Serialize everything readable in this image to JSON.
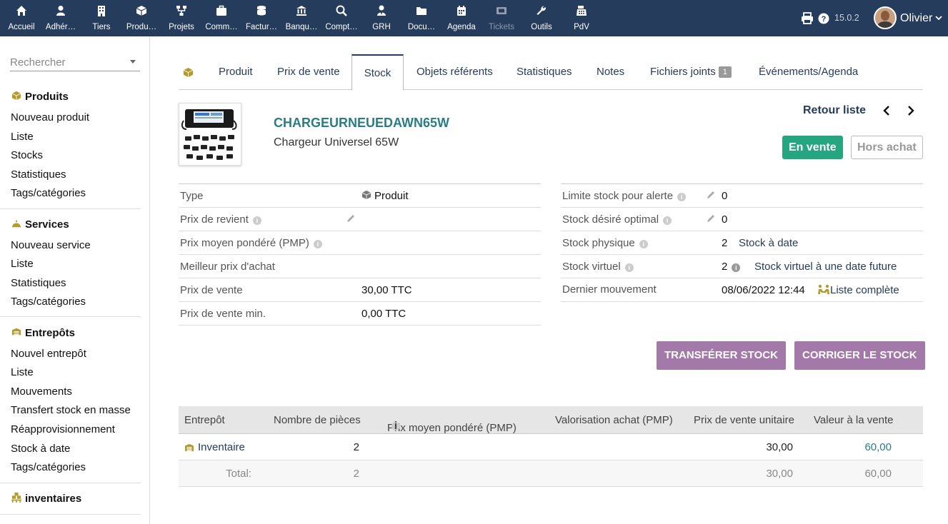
{
  "topnav": {
    "items": [
      {
        "label": "Accueil",
        "icon": "home-icon"
      },
      {
        "label": "Adhér…",
        "icon": "member-icon"
      },
      {
        "label": "Tiers",
        "icon": "building-icon"
      },
      {
        "label": "Produ…",
        "icon": "cube-icon"
      },
      {
        "label": "Projets",
        "icon": "project-icon"
      },
      {
        "label": "Comm…",
        "icon": "briefcase-icon"
      },
      {
        "label": "Factur…",
        "icon": "coins-icon"
      },
      {
        "label": "Banqu…",
        "icon": "bank-icon"
      },
      {
        "label": "Compt…",
        "icon": "search-dollar-icon"
      },
      {
        "label": "GRH",
        "icon": "user-tie-icon"
      },
      {
        "label": "Docu…",
        "icon": "folder-icon"
      },
      {
        "label": "Agenda",
        "icon": "calendar-icon"
      },
      {
        "label": "Tickets",
        "icon": "ticket-icon"
      },
      {
        "label": "Outils",
        "icon": "wrench-icon"
      },
      {
        "label": "PdV",
        "icon": "cash-register-icon"
      }
    ],
    "version": "15.0.2",
    "user": "Olivier"
  },
  "sidebar": {
    "search_placeholder": "Rechercher",
    "groups": [
      {
        "title": "Produits",
        "icon": "cube-icon",
        "items": [
          "Nouveau produit",
          "Liste",
          "Stocks",
          "Statistiques",
          "Tags/catégories"
        ]
      },
      {
        "title": "Services",
        "icon": "bell-service-icon",
        "items": [
          "Nouveau service",
          "Liste",
          "Statistiques",
          "Tags/catégories"
        ]
      },
      {
        "title": "Entrepôts",
        "icon": "boxes-icon",
        "items": [
          "Nouvel entrepôt",
          "Liste",
          "Mouvements",
          "Transfert stock en masse",
          "Réapprovisionnement",
          "Stock à date",
          "Tags/catégories"
        ]
      },
      {
        "title": "inventaires",
        "icon": "pallet-icon",
        "items": []
      }
    ]
  },
  "tabs": [
    {
      "label": "Produit"
    },
    {
      "label": "Prix de vente"
    },
    {
      "label": "Stock"
    },
    {
      "label": "Objets référents"
    },
    {
      "label": "Statistiques"
    },
    {
      "label": "Notes"
    },
    {
      "label": "Fichiers joints",
      "badge": "1"
    },
    {
      "label": "Événements/Agenda"
    }
  ],
  "product": {
    "ref": "CHARGEURNEUEDAWN65W",
    "name": "Chargeur Universel 65W",
    "back_label": "Retour liste",
    "status_sell": "En vente",
    "status_buy": "Hors achat"
  },
  "left_fields": [
    {
      "label": "Type",
      "value": "Produit"
    },
    {
      "label": "Prix de revient",
      "value": ""
    },
    {
      "label": "Prix moyen pondéré (PMP)",
      "value": ""
    },
    {
      "label": "Meilleur prix d'achat",
      "value": ""
    },
    {
      "label": "Prix de vente",
      "value": "30,00 TTC"
    },
    {
      "label": "Prix de vente min.",
      "value": "0,00 TTC"
    }
  ],
  "right_fields": [
    {
      "label": "Limite stock pour alerte",
      "value": "0"
    },
    {
      "label": "Stock désiré optimal",
      "value": "0"
    },
    {
      "label": "Stock physique",
      "value": "2",
      "link": "Stock à date"
    },
    {
      "label": "Stock virtuel",
      "value": "2",
      "link": "Stock virtuel à une date future"
    },
    {
      "label": "Dernier mouvement",
      "value": "08/06/2022 12:44",
      "link": "Liste complète"
    }
  ],
  "actions": {
    "transfer": "TRANSFÉRER STOCK",
    "correct": "CORRIGER LE STOCK"
  },
  "stock_table": {
    "headers": [
      "Entrepôt",
      "Nombre de pièces",
      "Prix moyen pondéré (PMP)",
      "Valorisation achat (PMP)",
      "Prix de vente unitaire",
      "Valeur à la vente"
    ],
    "rows": [
      {
        "warehouse": "Inventaire",
        "qty": "2",
        "pmp": "",
        "valo": "",
        "unit_price": "30,00",
        "sale_value": "60,00"
      }
    ],
    "total": {
      "label": "Total:",
      "qty": "2",
      "unit_price": "30,00",
      "sale_value": "60,00"
    }
  },
  "colors": {
    "topbar": "#263c5c",
    "accent_teal": "#2a7d86",
    "button_purple": "#a379a9",
    "status_green": "#25a580"
  }
}
